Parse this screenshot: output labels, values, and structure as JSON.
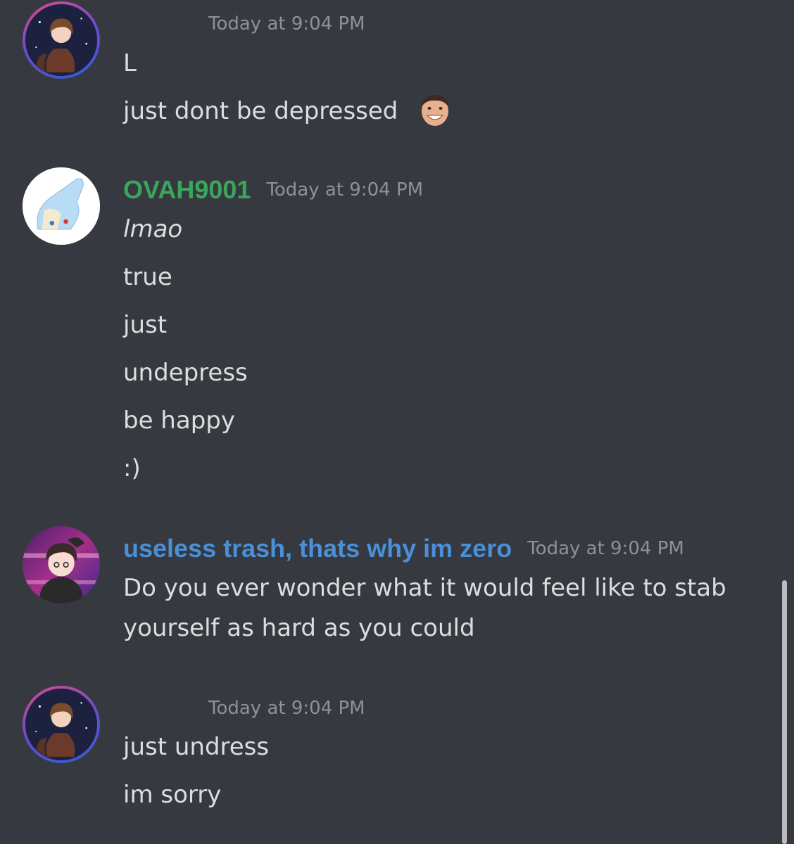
{
  "messages": [
    {
      "username": "",
      "timestamp": "Today at 9:04 PM",
      "lines": [
        "L",
        "just dont be depressed"
      ],
      "emoji": "grinning-man-face-emoji"
    },
    {
      "username": "OVAH9001",
      "username_color": "#3ba55c",
      "timestamp": "Today at 9:04 PM",
      "lines": [
        "lmao",
        "true",
        "just",
        "undepress",
        "be happy",
        ":)"
      ]
    },
    {
      "username": "useless trash, thats why im zero",
      "username_color": "#4a8fd8",
      "timestamp": "Today at 9:04 PM",
      "lines": [
        "Do you ever wonder what it would feel like to stab yourself as hard as you could"
      ]
    },
    {
      "username": "",
      "timestamp": "Today at 9:04 PM",
      "lines": [
        "just undress",
        "im sorry"
      ]
    }
  ],
  "colors": {
    "background": "#36393f",
    "message_text": "#dcddde",
    "timestamp": "#8e9297",
    "scrollbar": "#b9bbbe"
  }
}
